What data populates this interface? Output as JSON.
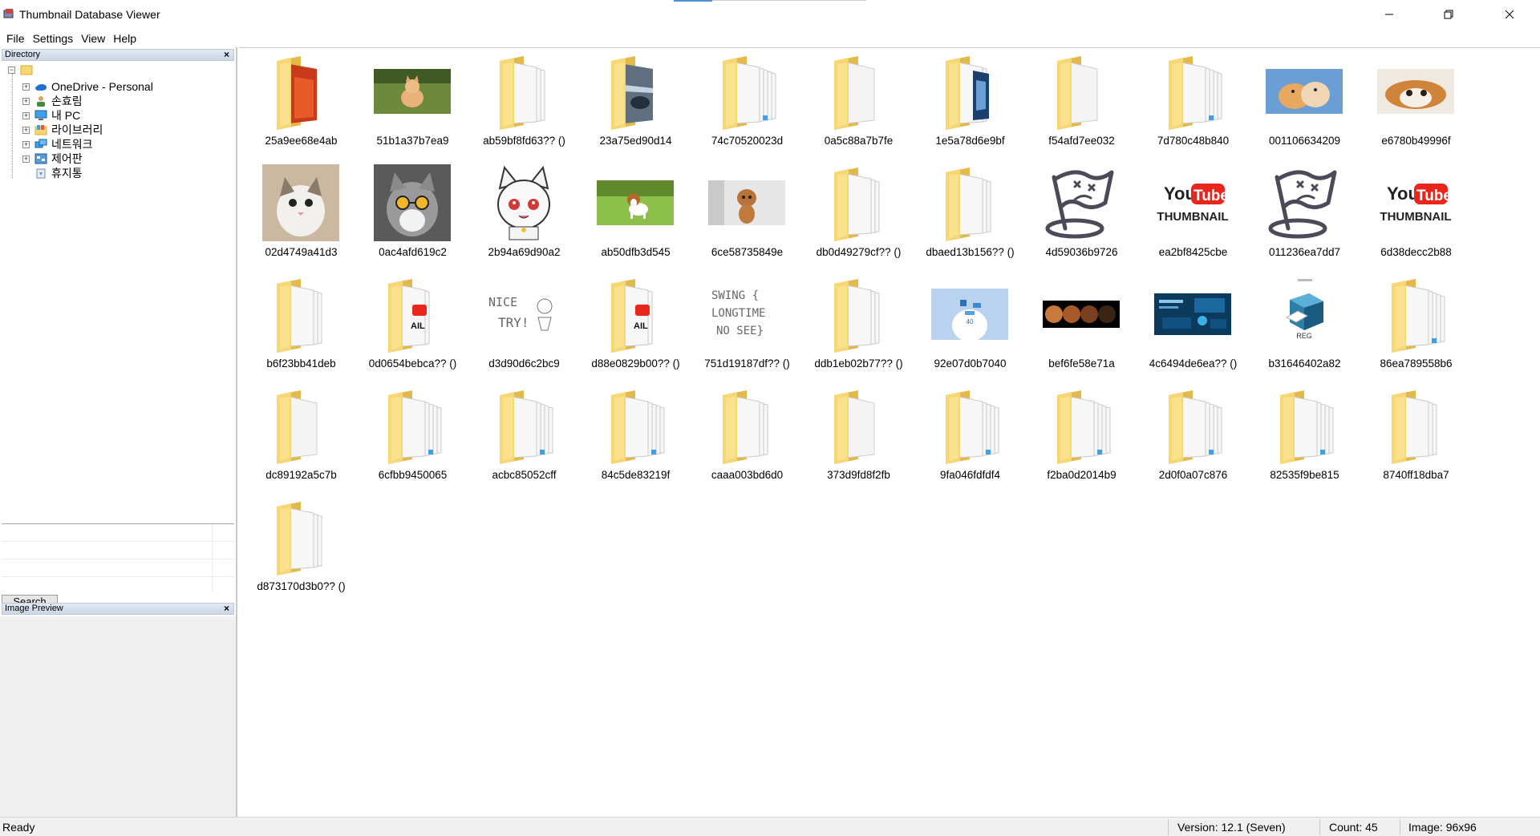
{
  "window": {
    "title": "Thumbnail Database Viewer"
  },
  "menu": [
    "File",
    "Settings",
    "View",
    "Help"
  ],
  "directory_panel": {
    "title": "Directory",
    "close": "×",
    "tree": [
      {
        "label": "OneDrive - Personal",
        "icon": "onedrive-icon"
      },
      {
        "label": "손효림",
        "icon": "user-icon"
      },
      {
        "label": "내 PC",
        "icon": "pc-icon"
      },
      {
        "label": "라이브러리",
        "icon": "library-icon"
      },
      {
        "label": "네트워크",
        "icon": "network-icon"
      },
      {
        "label": "제어판",
        "icon": "control-panel-icon"
      },
      {
        "label": "휴지통",
        "icon": "recycle-bin-icon"
      }
    ]
  },
  "search": {
    "button_label": "Search"
  },
  "preview_panel": {
    "title": "Image Preview",
    "close": "×"
  },
  "items": [
    {
      "label": "25a9ee68e4ab",
      "kind": "folder-photo"
    },
    {
      "label": "51b1a37b7ea9",
      "kind": "kitten"
    },
    {
      "label": "ab59bf8fd63?? ()",
      "kind": "folder-docs"
    },
    {
      "label": "23a75ed90d14",
      "kind": "folder-photo2"
    },
    {
      "label": "74c70520023d",
      "kind": "folder-many"
    },
    {
      "label": "0a5c88a7b7fe",
      "kind": "folder-empty"
    },
    {
      "label": "1e5a78d6e9bf",
      "kind": "folder-photo3"
    },
    {
      "label": "f54afd7ee032",
      "kind": "folder-empty"
    },
    {
      "label": "7d780c48b840",
      "kind": "folder-many"
    },
    {
      "label": "001106634209",
      "kind": "cats2"
    },
    {
      "label": "e6780b49996f",
      "kind": "cat-lying"
    },
    {
      "label": "02d4749a41d3",
      "kind": "cat-white"
    },
    {
      "label": "0ac4afd619c2",
      "kind": "cat-glasses"
    },
    {
      "label": "2b94a69d90a2",
      "kind": "anime"
    },
    {
      "label": "ab50dfb3d545",
      "kind": "beagle"
    },
    {
      "label": "6ce58735849e",
      "kind": "poodle"
    },
    {
      "label": "db0d49279cf?? ()",
      "kind": "folder-docs"
    },
    {
      "label": "dbaed13b156?? ()",
      "kind": "folder-docs"
    },
    {
      "label": "4d59036b9726",
      "kind": "flag"
    },
    {
      "label": "ea2bf8425cbe",
      "kind": "youtube"
    },
    {
      "label": "011236ea7dd7",
      "kind": "flag"
    },
    {
      "label": "6d38decc2b88",
      "kind": "youtube"
    },
    {
      "label": "b6f23bb41deb",
      "kind": "folder-docs"
    },
    {
      "label": "0d0654bebca?? ()",
      "kind": "folder-yt"
    },
    {
      "label": "d3d90d6c2bc9",
      "kind": "nice-try"
    },
    {
      "label": "d88e0829b00?? ()",
      "kind": "folder-yt"
    },
    {
      "label": "751d19187df?? ()",
      "kind": "swing"
    },
    {
      "label": "ddb1eb02b77?? ()",
      "kind": "folder-docs"
    },
    {
      "label": "92e07d0b7040",
      "kind": "blue-slide"
    },
    {
      "label": "bef6fe58e71a",
      "kind": "moons"
    },
    {
      "label": "4c6494de6ea?? ()",
      "kind": "dark-slide"
    },
    {
      "label": "b31646402a82",
      "kind": "reg"
    },
    {
      "label": "86ea789558b6",
      "kind": "folder-many"
    },
    {
      "label": "dc89192a5c7b",
      "kind": "folder-empty"
    },
    {
      "label": "6cfbb9450065",
      "kind": "folder-many"
    },
    {
      "label": "acbc85052cff",
      "kind": "folder-many"
    },
    {
      "label": "84c5de83219f",
      "kind": "folder-many"
    },
    {
      "label": "caaa003bd6d0",
      "kind": "folder-docs"
    },
    {
      "label": "373d9fd8f2fb",
      "kind": "folder-empty"
    },
    {
      "label": "9fa046fdfdf4",
      "kind": "folder-many"
    },
    {
      "label": "f2ba0d2014b9",
      "kind": "folder-many"
    },
    {
      "label": "2d0f0a07c876",
      "kind": "folder-many"
    },
    {
      "label": "82535f9be815",
      "kind": "folder-many"
    },
    {
      "label": "8740ff18dba7",
      "kind": "folder-docs"
    },
    {
      "label": "d873170d3b0?? ()",
      "kind": "folder-docs"
    }
  ],
  "thumb_text": {
    "youtube_you": "You",
    "youtube_tube": "Tube",
    "youtube_thumbnail": "THUMBNAIL",
    "nice_try_1": "NICE",
    "nice_try_2": "TRY!",
    "swing_1": "SWING {",
    "swing_2": "LONGTIME",
    "swing_3": "NO SEE}",
    "reg": "REG",
    "slide_number": "40",
    "folder_yt_1": "IL",
    "folder_yt_2": "AIL"
  },
  "status": {
    "ready": "Ready",
    "version": "Version: 12.1 (Seven)",
    "count": "Count: 45",
    "image": "Image: 96x96"
  },
  "colors": {
    "folder": "#f6d774",
    "folder_dark": "#e2b94a",
    "panel_header": "#cad6e6",
    "accent": "#4a90d9"
  }
}
